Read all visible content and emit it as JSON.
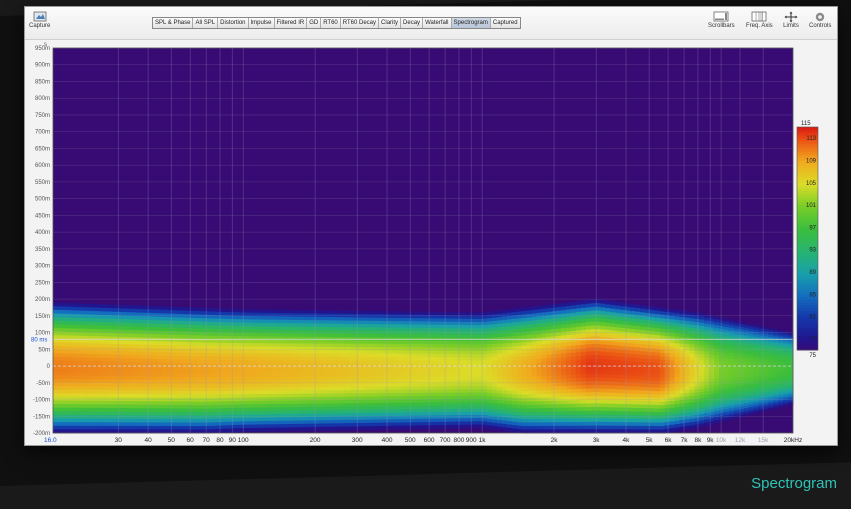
{
  "toolbar": {
    "capture": "Capture",
    "tabs": [
      "SPL & Phase",
      "All SPL",
      "Distortion",
      "Impulse",
      "Filtered IR",
      "GD",
      "RT60",
      "RT60 Decay",
      "Clarity",
      "Decay",
      "Waterfall",
      "Spectrogram",
      "Captured"
    ],
    "active_tab": "Spectrogram",
    "right_buttons": [
      "Scrollbars",
      "Freq. Axis",
      "Limits",
      "Controls"
    ]
  },
  "yaxis": {
    "unit": "s",
    "ticks": [
      "950m",
      "900m",
      "850m",
      "800m",
      "750m",
      "700m",
      "650m",
      "600m",
      "550m",
      "500m",
      "450m",
      "400m",
      "350m",
      "300m",
      "250m",
      "200m",
      "150m",
      "100m",
      "50m",
      "0",
      "-50m",
      "-100m",
      "-150m",
      "-200m"
    ],
    "highlight": "80 ms"
  },
  "xaxis": {
    "left_marker": "16.0",
    "ticks": [
      "30",
      "40",
      "50",
      "60",
      "70",
      "80",
      "90",
      "100",
      "200",
      "300",
      "400",
      "500",
      "600",
      "700",
      "800",
      "900",
      "1k",
      "2k",
      "3k",
      "4k",
      "5k",
      "6k",
      "7k",
      "8k",
      "9k",
      "10k",
      "12k",
      "15k",
      "20kHz"
    ]
  },
  "colorbar": {
    "ticks": [
      "115",
      "113",
      "109",
      "105",
      "101",
      "97",
      "93",
      "89",
      "85",
      "81",
      "77",
      "75"
    ]
  },
  "caption": "Spectrogram",
  "colors": {
    "background": "#1a1a1a",
    "plot": "#380a73",
    "accent": "#2ec4b6"
  },
  "chart_data": {
    "type": "heatmap",
    "title": "",
    "xlabel": "",
    "ylabel": "s",
    "x_scale": "log",
    "xlim": [
      16,
      20000
    ],
    "ylim": [
      -0.2,
      0.95
    ],
    "z_range": [
      75,
      115
    ],
    "color_ticks": [
      115,
      113,
      109,
      105,
      101,
      97,
      93,
      89,
      85,
      81,
      77,
      75
    ],
    "description": "",
    "band_center_s": 0,
    "band_halfwidth_s": [
      {
        "freq": 16,
        "halfwidth": 0.19
      },
      {
        "freq": 100,
        "halfwidth": 0.17
      },
      {
        "freq": 1000,
        "halfwidth": 0.16
      },
      {
        "freq": 3000,
        "halfwidth": 0.2
      },
      {
        "freq": 8000,
        "halfwidth": 0.16
      },
      {
        "freq": 20000,
        "halfwidth": 0.1
      }
    ],
    "peak_level_db": [
      {
        "freq": 16,
        "db": 111
      },
      {
        "freq": 100,
        "db": 109
      },
      {
        "freq": 1000,
        "db": 105
      },
      {
        "freq": 2800,
        "db": 114
      },
      {
        "freq": 5500,
        "db": 113
      },
      {
        "freq": 10000,
        "db": 101
      },
      {
        "freq": 20000,
        "db": 97
      }
    ]
  }
}
